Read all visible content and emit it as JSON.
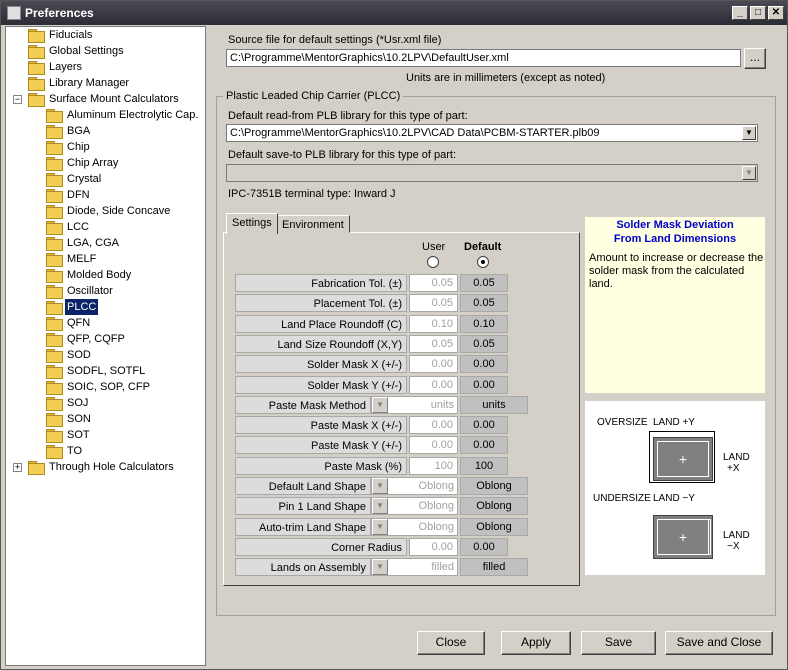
{
  "window": {
    "title": "Preferences",
    "minimize_glyph": "_",
    "maximize_glyph": "□",
    "close_glyph": "✕"
  },
  "tree": {
    "top_items": [
      "Fiducials",
      "Global Settings",
      "Layers",
      "Library Manager"
    ],
    "surface_mount": {
      "label": "Surface Mount Calculators",
      "expander": "−",
      "children": [
        "Aluminum Electrolytic Cap.",
        "BGA",
        "Chip",
        "Chip Array",
        "Crystal",
        "DFN",
        "Diode, Side Concave",
        "LCC",
        "LGA, CGA",
        "MELF",
        "Molded Body",
        "Oscillator",
        "PLCC",
        "QFN",
        "QFP, CQFP",
        "SOD",
        "SODFL, SOTFL",
        "SOIC, SOP, CFP",
        "SOJ",
        "SON",
        "SOT",
        "TO"
      ],
      "selected": "PLCC"
    },
    "through_hole": {
      "label": "Through Hole Calculators",
      "expander": "+"
    }
  },
  "source_file": {
    "label": "Source file for default settings (*Usr.xml file)",
    "value": "C:\\Programme\\MentorGraphics\\10.2LPV\\DefaultUser.xml",
    "browse_label": "...",
    "units_note": "Units are in millimeters (except as noted)"
  },
  "plcc_group": {
    "title": "Plastic Leaded Chip Carrier (PLCC)",
    "read_label": "Default read-from PLB library for this type of part:",
    "read_value": "C:\\Programme\\MentorGraphics\\10.2LPV\\CAD Data\\PCBM-STARTER.plb09",
    "save_label": "Default save-to PLB library for this type of part:",
    "save_value": "",
    "terminal_type": "IPC-7351B terminal type: Inward J"
  },
  "tabs": [
    "Settings",
    "Environment"
  ],
  "columns": {
    "user": "User",
    "default": "Default"
  },
  "rows": [
    {
      "label": "Fabrication Tol. (±)",
      "kind": "num",
      "user": "0.05",
      "default": "0.05"
    },
    {
      "label": "Placement Tol. (±)",
      "kind": "num",
      "user": "0.05",
      "default": "0.05"
    },
    {
      "label": "Land Place Roundoff (C)",
      "kind": "num",
      "user": "0.10",
      "default": "0.10"
    },
    {
      "label": "Land Size Roundoff (X,Y)",
      "kind": "num",
      "user": "0.05",
      "default": "0.05"
    },
    {
      "label": "Solder Mask X (+/-)",
      "kind": "num",
      "user": "0.00",
      "default": "0.00"
    },
    {
      "label": "Solder Mask Y (+/-)",
      "kind": "num",
      "user": "0.00",
      "default": "0.00"
    },
    {
      "label": "Paste Mask Method",
      "kind": "combo",
      "user": "units",
      "default": "units"
    },
    {
      "label": "Paste Mask X (+/-)",
      "kind": "num",
      "user": "0.00",
      "default": "0.00"
    },
    {
      "label": "Paste Mask Y (+/-)",
      "kind": "num",
      "user": "0.00",
      "default": "0.00"
    },
    {
      "label": "Paste Mask (%)",
      "kind": "num",
      "user": "100",
      "default": "100"
    },
    {
      "label": "Default Land Shape",
      "kind": "combo",
      "user": "Oblong",
      "default": "Oblong"
    },
    {
      "label": "Pin 1 Land Shape",
      "kind": "combo",
      "user": "Oblong",
      "default": "Oblong"
    },
    {
      "label": "Auto-trim Land Shape",
      "kind": "combo",
      "user": "Oblong",
      "default": "Oblong"
    },
    {
      "label": "Corner Radius",
      "kind": "num",
      "user": "0.00",
      "default": "0.00"
    },
    {
      "label": "Lands on Assembly",
      "kind": "combo",
      "user": "filled",
      "default": "filled"
    }
  ],
  "info": {
    "title_line1": "Solder Mask Deviation",
    "title_line2": "From Land Dimensions",
    "desc_line1": "Amount to increase or decrease the",
    "desc_line2": "solder mask from the calculated",
    "desc_line3": "land.",
    "title_color": "#0000cc"
  },
  "diagram": {
    "oversize": "OVERSIZE",
    "land_plus_y": "LAND +Y",
    "land": "LAND",
    "plus_x": "+X",
    "undersize": "UNDERSIZE",
    "land_minus_y": "LAND −Y",
    "minus_x": "−X",
    "plus_sign": "+"
  },
  "buttons": {
    "close": "Close",
    "apply": "Apply",
    "save": "Save",
    "save_close": "Save and Close"
  }
}
